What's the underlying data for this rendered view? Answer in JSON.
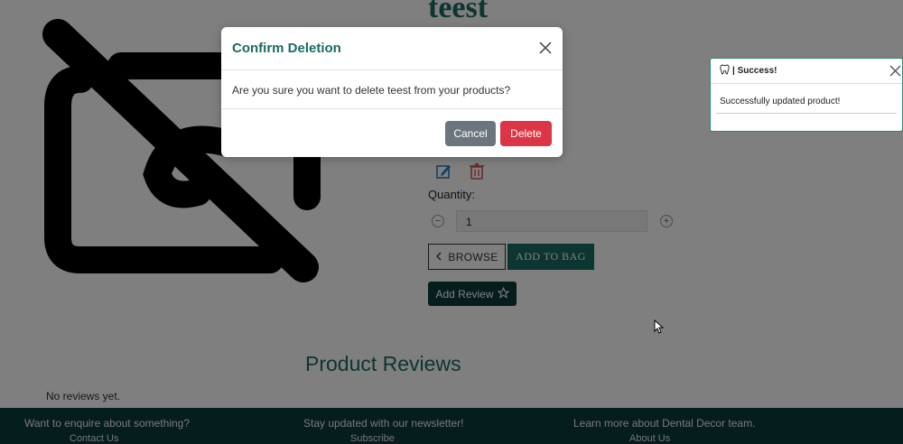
{
  "product": {
    "name": "teest",
    "image_icon": "no-image-icon",
    "edit_icon": "edit-icon",
    "delete_icon": "trash-icon",
    "quantity_label": "Quantity:",
    "quantity_value": "1",
    "browse_label": "BROWSE",
    "add_to_bag_label": "ADD TO BAG",
    "add_review_label": "Add Review"
  },
  "reviews": {
    "title": "Product Reviews",
    "empty_text": "No reviews yet."
  },
  "footer": {
    "col1_text": "Want to enquire about something?",
    "col1_sub": "Contact Us",
    "col2_text": "Stay updated with our newsletter!",
    "col2_sub": "Subscribe",
    "col3_text": "Learn more about Dental Decor team.",
    "col3_sub": "About Us"
  },
  "modal": {
    "title": "Confirm Deletion",
    "message": "Are you sure you want to delete teest from your products?",
    "cancel_label": "Cancel",
    "delete_label": "Delete"
  },
  "toast": {
    "title": "| Success!",
    "message": "Successfully updated product!",
    "icon": "tooth-icon"
  },
  "colors": {
    "brand_teal": "#1a6b64",
    "footer_dark": "#0d3b3a",
    "danger": "#dc3545",
    "secondary": "#6c757d"
  }
}
